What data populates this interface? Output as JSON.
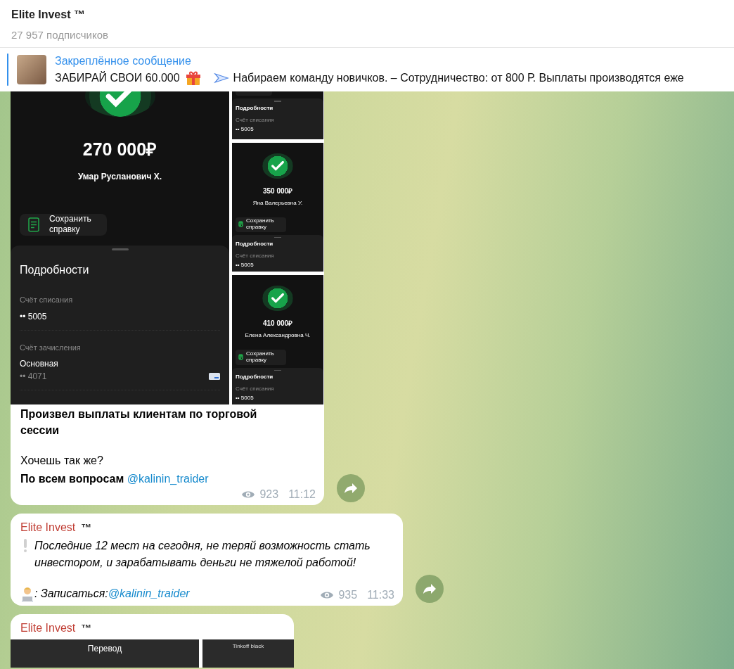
{
  "header": {
    "title": "Elite Invest ™",
    "subtitle": "27 957 подписчиков"
  },
  "pinned": {
    "label": "Закреплённое сообщение",
    "text_start": "ЗАБИРАЙ СВОИ 60.000",
    "text_end": "Набираем команду новичков.   – Сотрудничество: от 800 Р. Выплаты производятся еже"
  },
  "messages": [
    {
      "kind": "media_post",
      "media": {
        "main": {
          "amount": "270 000₽",
          "name": "Умар Русланович Х.",
          "save_label": "Сохранить справку",
          "details_title": "Подробности",
          "fields": [
            {
              "label": "Счёт списания",
              "value": "•• 5005"
            },
            {
              "label": "Счёт зачисления",
              "value": "Основная",
              "sub": "•• 4071"
            }
          ]
        },
        "tiles": [
          {
            "kind": "details",
            "details_title": "Подробности",
            "field_label": "Счёт списания",
            "field_value": "•• 5005"
          },
          {
            "kind": "full",
            "amount": "350 000₽",
            "name": "Яна Валерьевна У.",
            "save_label": "Сохранить справку",
            "details_title": "Подробности",
            "field_label": "Счёт списания",
            "field_value": "•• 5005"
          },
          {
            "kind": "full",
            "amount": "410 000₽",
            "name": "Елена Александровна Ч.",
            "save_label": "Сохранить справку",
            "details_title": "Подробности",
            "field_label": "Счёт списания",
            "field_value": "•• 5005"
          }
        ]
      },
      "headline": "Произвел выплаты клиентам по торговой сессии",
      "question": "Хочешь так же?",
      "contact": "**По всем вопросам** ",
      "link": "@kalinin_traider",
      "views": "923",
      "time": "11:12"
    },
    {
      "kind": "text_post",
      "sender": "Elite Invest",
      "sender_badge": "™",
      "body": "Последние 12 мест на сегодня, не теряй возможность стать инвестором, и зарабатывать деньги не тяжелой работой!",
      "signup": ": Записаться: ",
      "link": "@kalinin_traider",
      "views": "935",
      "time": "11:33"
    },
    {
      "kind": "media_header",
      "sender": "Elite Invest",
      "sender_badge": "™",
      "left_title": "Перевод",
      "right_title": "Tinkoff black"
    }
  ]
}
